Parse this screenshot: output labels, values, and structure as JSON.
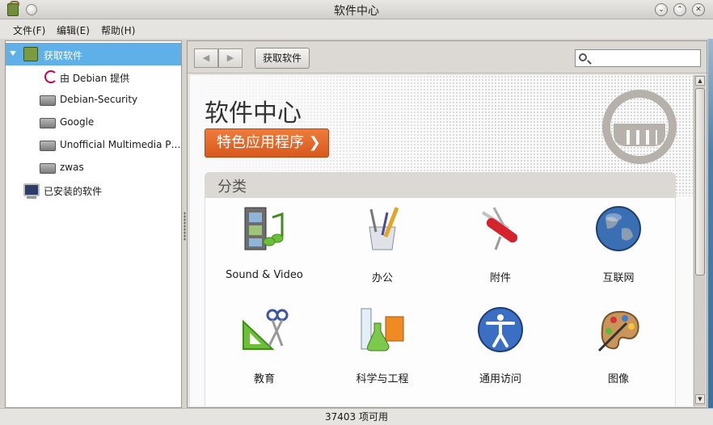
{
  "window": {
    "title": "软件中心"
  },
  "menubar": {
    "file": "文件(F)",
    "edit": "编辑(E)",
    "help": "帮助(H)"
  },
  "sidebar": {
    "items": [
      {
        "label": "获取软件",
        "icon": "software-bag-icon"
      },
      {
        "label": "由 Debian 提供",
        "icon": "debian-swirl-icon"
      },
      {
        "label": "Debian-Security",
        "icon": "disk-icon"
      },
      {
        "label": "Google",
        "icon": "disk-icon"
      },
      {
        "label": "Unofficial Multimedia P…",
        "icon": "disk-icon"
      },
      {
        "label": "zwas",
        "icon": "disk-icon"
      },
      {
        "label": "已安装的软件",
        "icon": "computer-icon"
      }
    ]
  },
  "toolbar": {
    "back": "◀",
    "forward": "▶",
    "get_software": "获取软件",
    "search_placeholder": ""
  },
  "main": {
    "title": "软件中心",
    "featured_button": "特色应用程序 ❯",
    "categories_header": "分类",
    "categories": [
      {
        "label": "Sound & Video",
        "icon": "film-music-icon"
      },
      {
        "label": "办公",
        "icon": "office-pencil-icon"
      },
      {
        "label": "附件",
        "icon": "swiss-knife-icon"
      },
      {
        "label": "互联网",
        "icon": "globe-icon"
      },
      {
        "label": "教育",
        "icon": "ruler-scissors-icon"
      },
      {
        "label": "科学与工程",
        "icon": "flask-icon"
      },
      {
        "label": "通用访问",
        "icon": "accessibility-icon"
      },
      {
        "label": "图像",
        "icon": "paint-palette-icon"
      }
    ]
  },
  "status": {
    "text": "37403 项可用"
  },
  "colors": {
    "selection": "#5fb0e8",
    "featured": "#e8692a",
    "logo": "#b6b1ab"
  }
}
